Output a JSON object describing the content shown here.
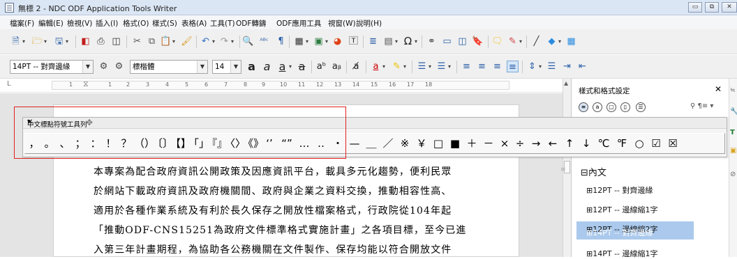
{
  "window": {
    "title": "無標 2 - NDC ODF Application Tools Writer",
    "min": "▭",
    "max": "⧉",
    "close": "✕"
  },
  "menu": [
    "檔案(F)",
    "編輯(E)",
    "檢視(V)",
    "插入(I)",
    "格式(O)",
    "樣式(S)",
    "表格(A)",
    "工具(T)",
    "ODF轉鑄",
    "ODF應用工具",
    "視窗(W)",
    "說明(H)"
  ],
  "toolbar1": {
    "icons": [
      "new-icon",
      "open-icon",
      "save-icon",
      "pdf-icon",
      "print-icon",
      "preview-icon",
      "cut-icon",
      "copy-icon",
      "paste-icon",
      "clone-icon",
      "undo-icon",
      "redo-icon",
      "find-icon",
      "spellcheck-icon",
      "pilcrow-icon",
      "table-icon",
      "image-icon",
      "chart-icon",
      "textbox-icon",
      "pagebreak-icon",
      "field-icon",
      "special-char-icon",
      "hyperlink-icon",
      "footnote-icon",
      "comment-icon",
      "bookmark-icon",
      "track-icon",
      "line-icon",
      "shapes-icon",
      "grid-icon"
    ]
  },
  "toolbar2": {
    "para_style": "14PT -- 對齊邊緣",
    "font_name": "標楷體",
    "font_size": "14"
  },
  "ruler": {
    "marks": [
      "1",
      "1",
      "1",
      "2",
      "3",
      "4",
      "5",
      "6",
      "7",
      "8",
      "9",
      "10",
      "11",
      "12",
      "13",
      "14",
      "15",
      "16",
      "17",
      "18"
    ]
  },
  "document": {
    "lines": [
      "本專案為配合政府資訊公開政策及因應資訊平台，載具多元化趨勢，便利民眾",
      "於網站下載政府資訊及政府機關間、政府與企業之資料交換，推動相容性高、",
      "適用於各種作業系統及有利於長久保存之開放性檔案格式，行政院從104年起",
      "「推動ODF-CNS15251為政府文件標準格式實施計畫」之各項目標，至今已進",
      "入第三年計畫期程，為協助各公務機關在文件製作、保存均能以符合開放文件"
    ]
  },
  "cjk_toolbar": {
    "title": "中文標點符號工具列",
    "chars": [
      "，",
      "。",
      "、",
      "；",
      "：",
      "！",
      "？",
      "（）",
      "〔〕",
      "【】",
      "「」",
      "『』",
      "〈〉",
      "《》",
      "‘’",
      "“”",
      "…",
      "‥",
      "・",
      "—",
      "＿",
      "／",
      "※",
      "￥",
      "□",
      "■",
      "＋",
      "－",
      "×",
      "÷",
      "→",
      "←",
      "↑",
      "↓",
      "℃",
      "℉",
      "○",
      "☑",
      "☒"
    ]
  },
  "styles_panel": {
    "title": "樣式和格式設定",
    "close": "✕",
    "tree": [
      {
        "label": "⊟內文"
      },
      {
        "label": "⊞12PT -- 對齊邊緣"
      },
      {
        "label": "⊞12PT -- 邊線縮1字"
      },
      {
        "label": "⊞12PT -- 邊線縮2字"
      },
      {
        "label": "⊞14PT -- 對齊邊緣",
        "selected": true
      },
      {
        "label": "⊞14PT -- 邊線縮1字"
      }
    ]
  },
  "colors": {
    "accent": "#2b5fa8",
    "selection": "#aac9ec",
    "highlight_box": "#e02020"
  }
}
